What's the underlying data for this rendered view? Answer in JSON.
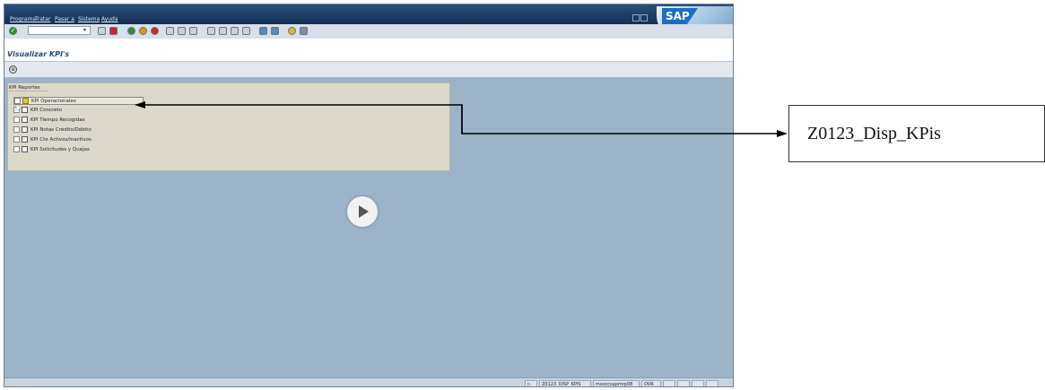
{
  "menu": [
    "Programa",
    "Tratar",
    "Pasar a",
    "Sistema",
    "Ayuda"
  ],
  "brand": "SAP",
  "page_title": "Visualizar KPI's",
  "tree": {
    "header": "KPI Reportes",
    "items": [
      {
        "label": "KPI Operacionales",
        "icon": "folder-open-icon"
      },
      {
        "label": "KPI Concreto",
        "icon": "report-icon"
      },
      {
        "label": "KPI Tiempo Recogidas",
        "icon": "report-icon"
      },
      {
        "label": "KPI Notas Crédito/Débito",
        "icon": "report-icon"
      },
      {
        "label": "KPI Cte Activos/Inactivos",
        "icon": "report-icon"
      },
      {
        "label": "KPI Solicitudes y Quejas",
        "icon": "report-icon"
      }
    ]
  },
  "status_bar": {
    "transaction": "Z0123_DISP_KPIS",
    "server": "msoccsapmrp08",
    "mode": "OVR"
  },
  "callout": {
    "text": "Z0123_Disp_KPis"
  },
  "colors": {
    "menubar": "#1c3b63",
    "canvas": "#9db3c8",
    "tree_panel": "#dcd9cc"
  }
}
